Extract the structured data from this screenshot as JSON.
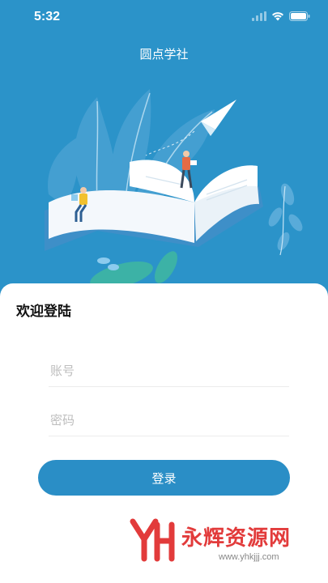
{
  "status_bar": {
    "time": "5:32"
  },
  "header": {
    "title": "圆点学社"
  },
  "login": {
    "welcome": "欢迎登陆",
    "account_placeholder": "账号",
    "password_placeholder": "密码",
    "submit_label": "登录"
  },
  "watermark": {
    "name": "永辉资源网",
    "url": "www.yhkjjj.com"
  },
  "colors": {
    "primary": "#2b93c9",
    "button": "#2a8ec6",
    "watermark_red": "#e23b3b"
  },
  "icons": [
    "signal-icon",
    "wifi-icon",
    "battery-icon",
    "paper-plane-icon",
    "open-book-illustration"
  ]
}
